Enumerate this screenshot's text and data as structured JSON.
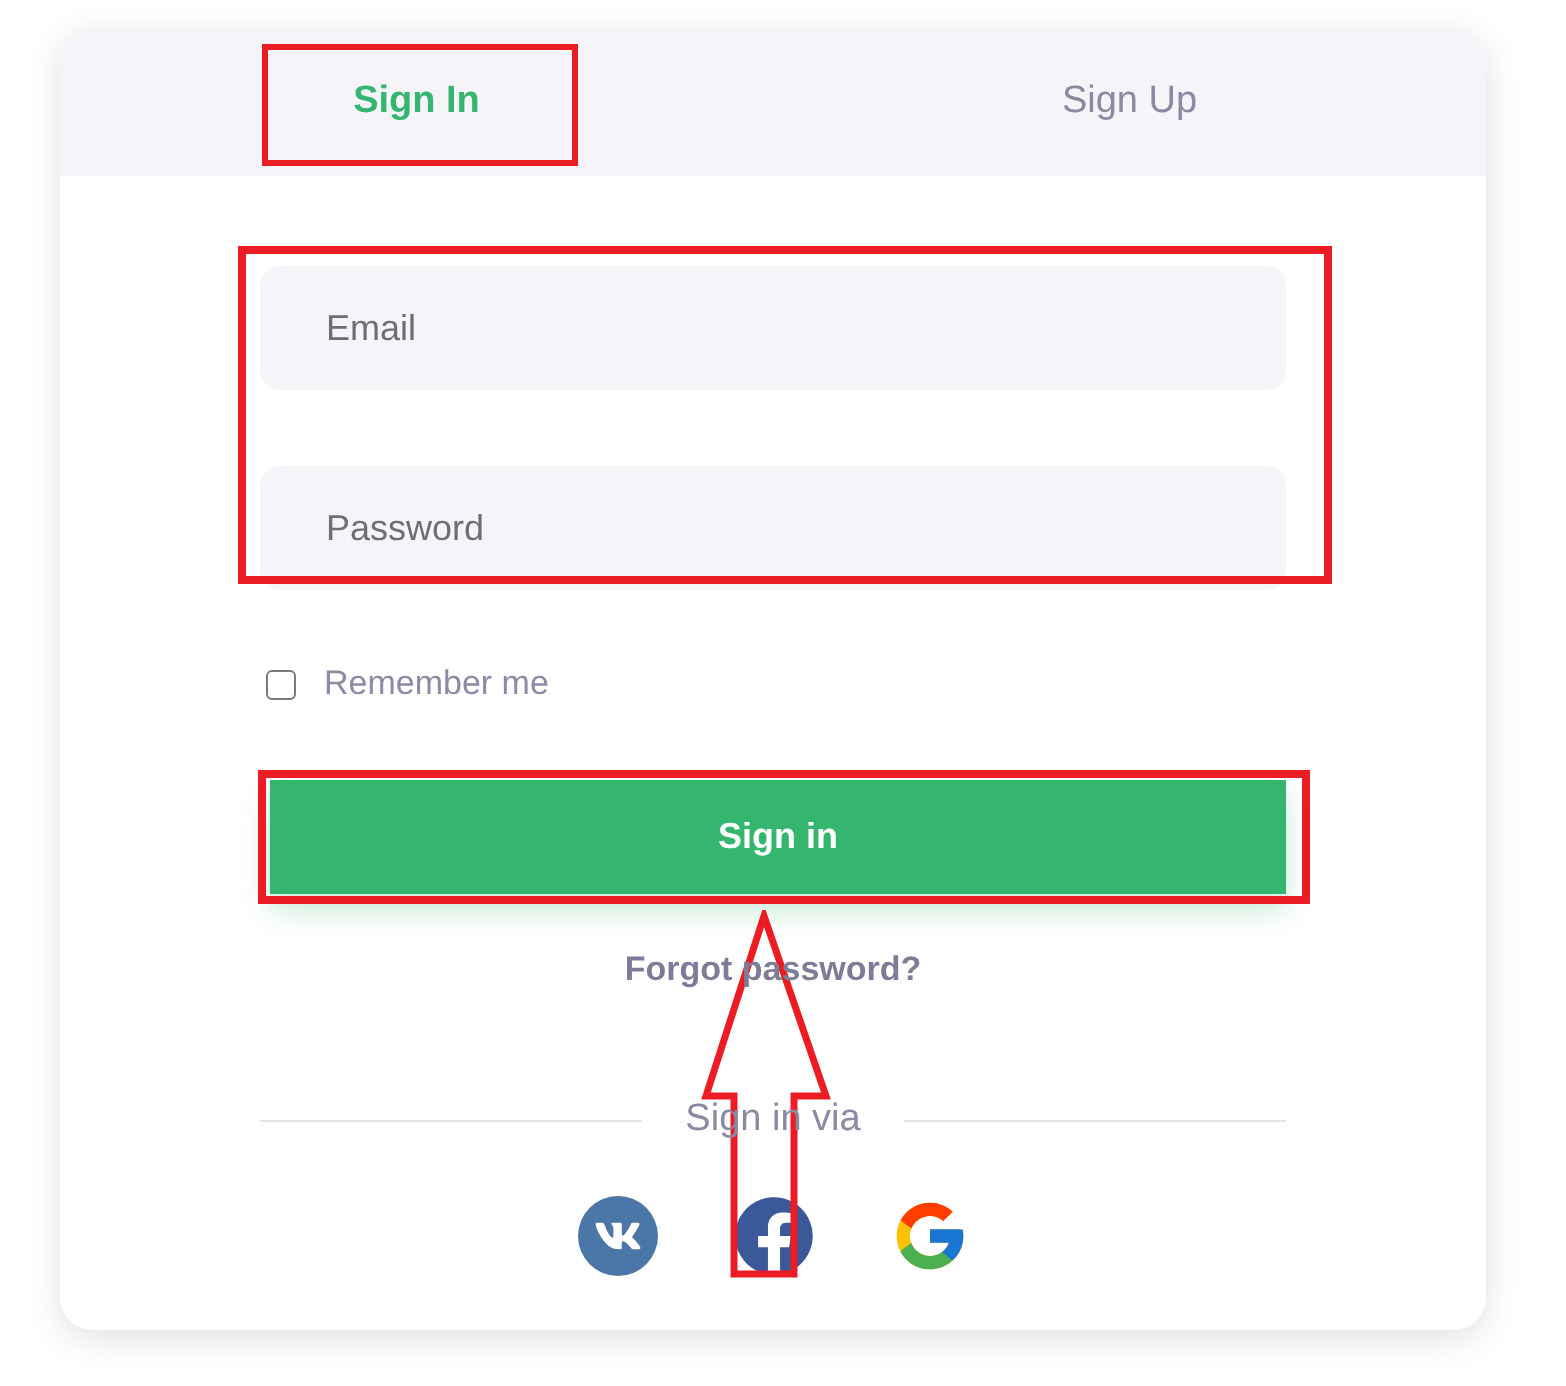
{
  "tabs": [
    {
      "label": "Sign In",
      "selected": true,
      "highlighted": true
    },
    {
      "label": "Sign Up",
      "selected": false,
      "highlighted": false
    }
  ],
  "form": {
    "highlighted": true,
    "fields": [
      {
        "placeholder": "Email"
      },
      {
        "placeholder": "Password"
      }
    ]
  },
  "remember": {
    "label": "Remember me",
    "checked": false
  },
  "submit": {
    "label": "Sign in",
    "highlighted": true,
    "arrow": true
  },
  "forgot_link": "Forgot password?",
  "social": {
    "label": "Sign in via",
    "providers": [
      {
        "kind": "vk"
      },
      {
        "kind": "facebook"
      },
      {
        "kind": "google"
      }
    ]
  }
}
